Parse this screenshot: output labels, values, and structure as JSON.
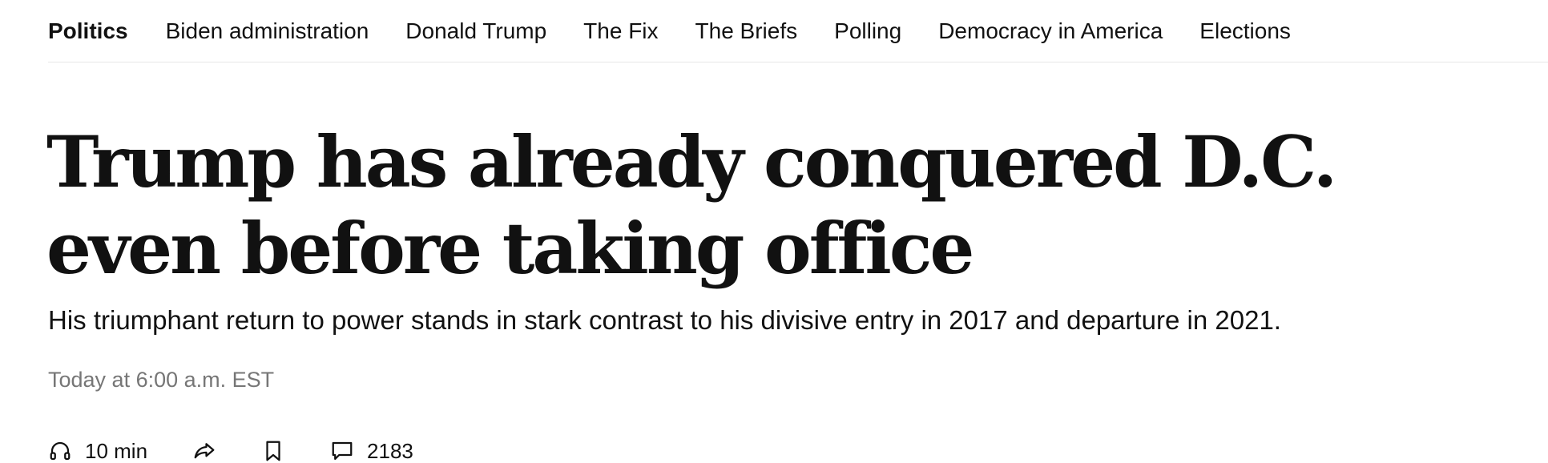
{
  "subnav": {
    "section": "Politics",
    "links": [
      "Biden administration",
      "Donald Trump",
      "The Fix",
      "The Briefs",
      "Polling",
      "Democracy in America",
      "Elections"
    ]
  },
  "article": {
    "headline": "Trump has already conquered D.C. even before taking office",
    "subheadline": "His triumphant return to power stands in stark contrast to his divisive entry in 2017 and departure in 2021.",
    "timestamp": "Today at 6:00 a.m. EST"
  },
  "actions": {
    "listen_icon": "headphones-icon",
    "listen_duration": "10 min",
    "share_icon": "share-arrow-icon",
    "save_icon": "bookmark-icon",
    "comments_icon": "comment-bubble-icon",
    "comment_count": "2183"
  },
  "colors": {
    "text": "#111111",
    "muted": "#767676",
    "divider": "#e6e6e6"
  }
}
